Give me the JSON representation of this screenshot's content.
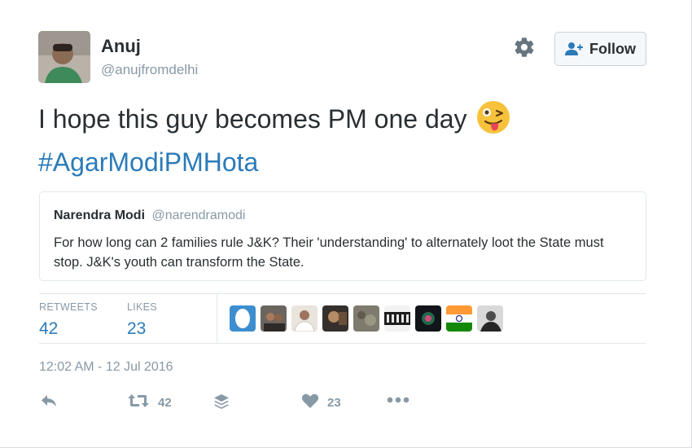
{
  "author": {
    "name": "Anuj",
    "handle": "@anujfromdelhi"
  },
  "follow_label": "Follow",
  "tweet": {
    "text": "I hope this guy becomes PM one day",
    "hashtag": "#AgarModiPMHota"
  },
  "quoted_tweet": {
    "name": "Narendra Modi",
    "handle": "@narendramodi",
    "text": "For how long can 2 families rule J&K? Their 'understanding' to alternately loot the State must stop. J&K's youth can transform the State."
  },
  "stats": {
    "retweets_label": "RETWEETS",
    "retweets_value": "42",
    "likes_label": "LIKES",
    "likes_value": "23"
  },
  "timestamp": "12:02 AM - 12 Jul 2016",
  "actions": {
    "retweet_count": "42",
    "like_count": "23"
  },
  "colors": {
    "link": "#2b7bb9",
    "muted": "#8899a6",
    "text": "#292f33"
  },
  "icons": [
    "gear-icon",
    "follow-person-icon",
    "reply-icon",
    "retweet-icon",
    "buffer-icon",
    "heart-icon",
    "more-icon",
    "tongue-emoji"
  ]
}
